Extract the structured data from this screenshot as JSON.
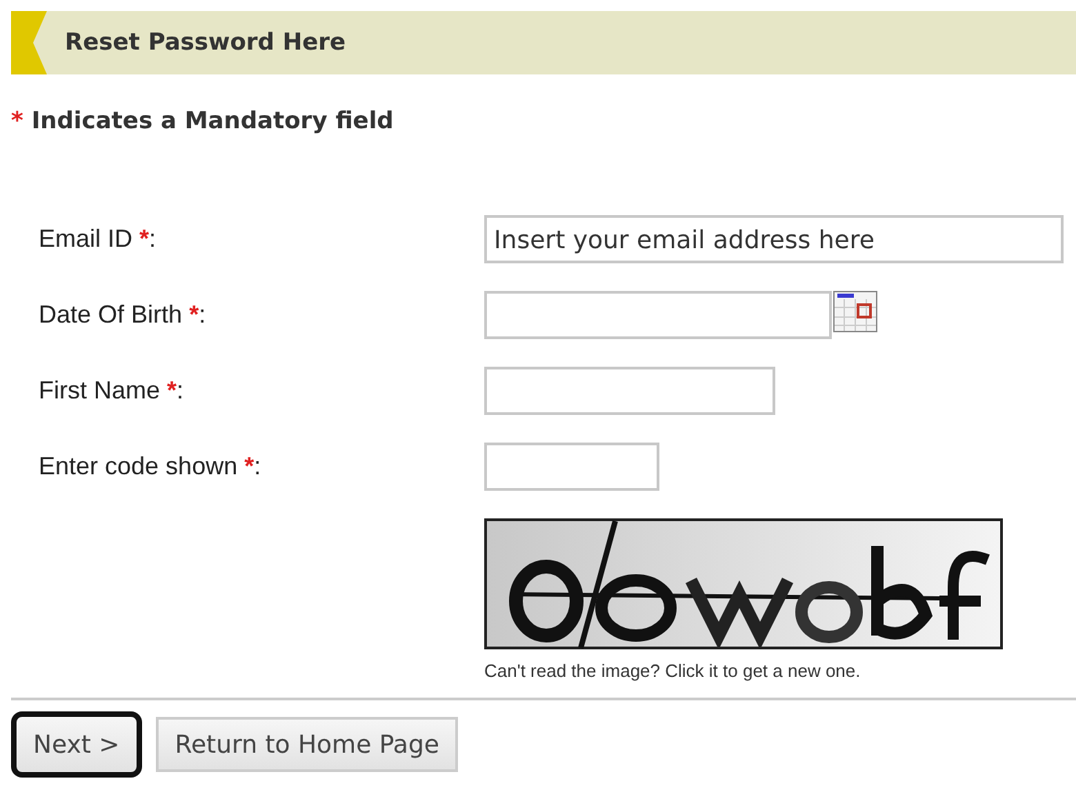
{
  "header": {
    "title": "Reset Password Here"
  },
  "legend": {
    "mark": "*",
    "text": "Indicates a Mandatory field"
  },
  "fields": [
    {
      "kind": "text",
      "label": "Email ID",
      "required_mark": "*",
      "suffix": ":",
      "value": "Insert your email address here"
    },
    {
      "kind": "date",
      "label": "Date Of Birth",
      "required_mark": "*",
      "suffix": ":"
    },
    {
      "kind": "name",
      "label": "First Name",
      "required_mark": "*",
      "suffix": ":"
    },
    {
      "kind": "code",
      "label": "Enter code shown",
      "required_mark": "*",
      "suffix": ":"
    }
  ],
  "captcha": {
    "kind": "picture",
    "note": "Can't read the image? Click it to get a new one."
  },
  "buttons": [
    {
      "label": "Next >",
      "focused": true
    },
    {
      "label": "Return to Home Page",
      "focused": false
    }
  ]
}
